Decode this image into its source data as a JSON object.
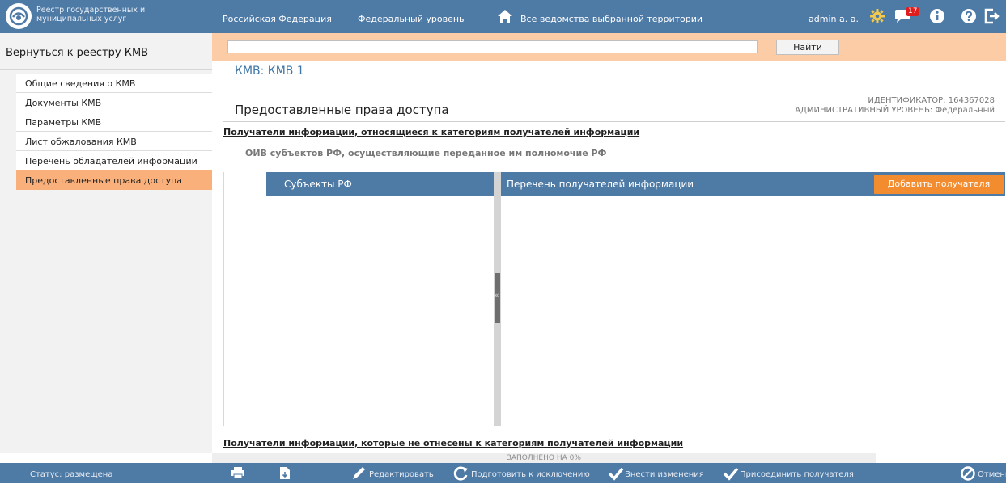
{
  "header": {
    "logo_text": "Реестр государственных и муниципальных услуг",
    "region": "Российская Федерация",
    "level": "Федеральный уровень",
    "departments": "Все ведомства выбранной территории",
    "user": "admin a. a.",
    "notification_count": "17"
  },
  "sidebar": {
    "back_link": "Вернуться к реестру КМВ",
    "items": [
      {
        "label": "Общие сведения о КМВ"
      },
      {
        "label": "Документы КМВ"
      },
      {
        "label": "Параметры КМВ"
      },
      {
        "label": "Лист обжалования КМВ"
      },
      {
        "label": "Перечень обладателей информации"
      },
      {
        "label": "Предоставленные права доступа"
      }
    ]
  },
  "search": {
    "value": "",
    "placeholder": "",
    "button_label": "Найти"
  },
  "main": {
    "kmv_title": "КМВ: КМВ 1",
    "page_title": "Предоставленные права доступа",
    "identifier": "ИДЕНТИФИКАТОР: 164367028",
    "admin_level": "АДМИНИСТРАТИВНЫЙ УРОВЕНЬ: Федеральный",
    "section1": "Получатели информации, относящиеся к категориям получателей информации",
    "subsection1": "ОИВ субъектов РФ, осуществляющие переданное им полномочие РФ",
    "left_header": "Субъекты РФ",
    "right_header": "Перечень получателей информации",
    "add_button": "Добавить получателя",
    "section2": "Получатели информации, которые не отнесены к категориям получателей информации"
  },
  "footer": {
    "progress_label": "ЗАПОЛНЕНО НА 0%",
    "progress_percent": 0,
    "status_label": "Статус:",
    "status_value": "размещена",
    "edit": "Редактировать",
    "prepare_exclusion": "Подготовить к исключению",
    "make_changes": "Внести изменения",
    "attach_recipient": "Присоединить получателя",
    "cancel": "Отменить"
  },
  "colors": {
    "header_blue": "#4e7aa6",
    "active_orange": "#f9b07a",
    "search_bar": "#fbcca6",
    "accent_orange": "#f28c2e",
    "title_blue": "#3e76a8",
    "badge_red": "#e21b1b"
  },
  "icons": [
    "emblem-icon",
    "home-icon",
    "gear-icon",
    "chat-icon",
    "info-icon",
    "help-icon",
    "logout-icon",
    "print-icon",
    "export-icon",
    "pencil-icon",
    "refresh-icon",
    "check-icon",
    "cancel-icon"
  ]
}
